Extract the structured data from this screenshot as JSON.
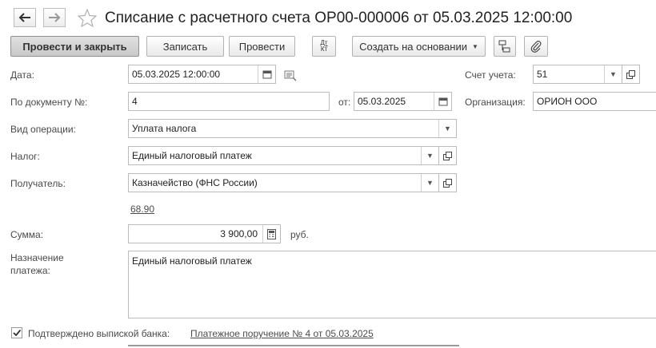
{
  "window": {
    "title": "Списание с расчетного счета ОР00-000006 от 05.03.2025 12:00:00"
  },
  "toolbar": {
    "post_and_close": "Провести и закрыть",
    "save": "Записать",
    "post": "Провести",
    "dt_kt_top": "Дт",
    "dt_kt_bottom": "Кт",
    "create_based_on": "Создать на основании"
  },
  "form": {
    "date_label": "Дата:",
    "date_value": "05.03.2025 12:00:00",
    "account_label": "Счет учета:",
    "account_value": "51",
    "doc_number_label": "По документу №:",
    "doc_number_value": "4",
    "doc_date_label": "от:",
    "doc_date_value": "05.03.2025",
    "organization_label": "Организация:",
    "organization_value": "ОРИОН ООО",
    "operation_label": "Вид операции:",
    "operation_value": "Уплата налога",
    "tax_label": "Налог:",
    "tax_value": "Единый налоговый платеж",
    "recipient_label": "Получатель:",
    "recipient_value": "Казначейство (ФНС России)",
    "recipient_link": "68.90",
    "amount_label": "Сумма:",
    "amount_value": "3 900,00",
    "currency": "руб.",
    "purpose_label_line1": "Назначение",
    "purpose_label_line2": "платежа:",
    "purpose_value": "Единый налоговый платеж",
    "confirmed_label": "Подтверждено выпиской банка:",
    "confirmed_checked": true,
    "payment_order_link": "Платежное поручение № 4 от 05.03.2025"
  },
  "icons": {
    "back": "arrow-left-icon",
    "forward": "arrow-right-icon",
    "favorite": "star-icon",
    "calendar": "calendar-icon",
    "history": "history-icon",
    "dropdown": "chevron-down-icon",
    "open": "open-icon",
    "calculator": "calculator-icon",
    "structure": "structure-icon",
    "attach": "paperclip-icon",
    "check": "checkmark-icon"
  },
  "colors": {
    "primary_button": "#d6d6d6",
    "border": "#bcbcbc",
    "link": "#4c4c4c"
  }
}
